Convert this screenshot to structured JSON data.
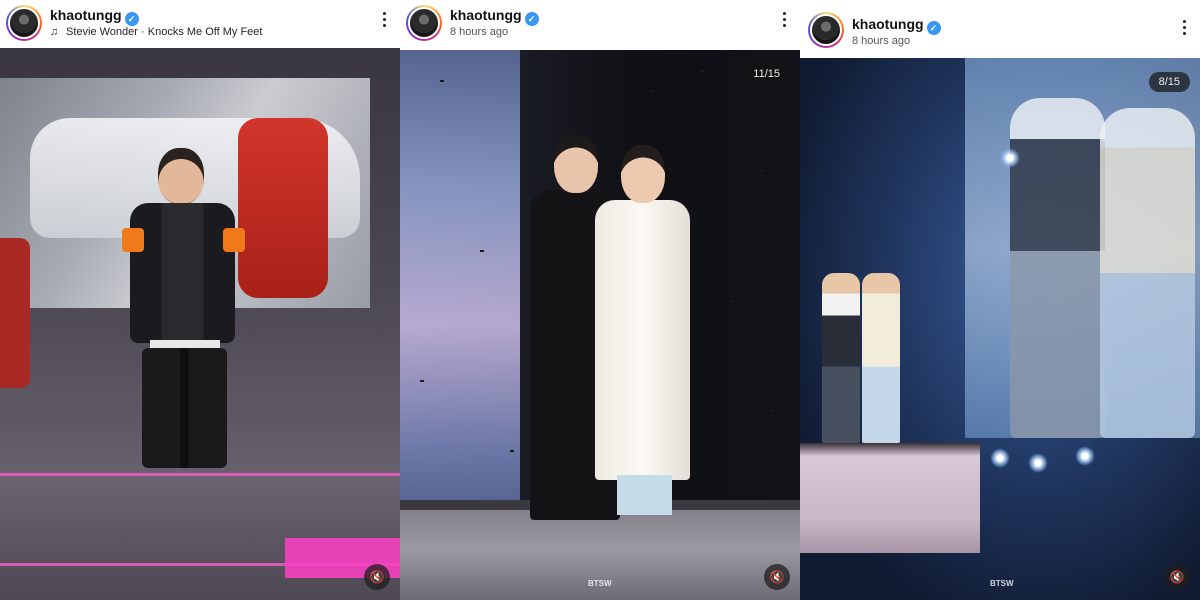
{
  "posts": [
    {
      "username": "khaotungg",
      "verified": true,
      "music_artist": "Stevie Wonder",
      "music_separator": "·",
      "music_title": "Knocks Me Off My Feet",
      "counter": "",
      "watermark": "",
      "icons": {
        "music": "music-note-icon",
        "verified": "verified-badge-icon",
        "more": "more-options-icon",
        "mute": "muted-speaker-icon"
      }
    },
    {
      "username": "khaotungg",
      "verified": true,
      "time": "8 hours ago",
      "counter": "11/15",
      "watermark": "BTSW",
      "icons": {
        "verified": "verified-badge-icon",
        "more": "more-options-icon",
        "mute": "muted-speaker-icon"
      }
    },
    {
      "username": "khaotungg",
      "verified": true,
      "time": "8 hours ago",
      "counter": "8/15",
      "watermark": "BTSW",
      "icons": {
        "verified": "verified-badge-icon",
        "more": "more-options-icon",
        "mute": "muted-speaker-icon"
      }
    }
  ],
  "colors": {
    "verified": "#3897f0",
    "stage_pink": "#ff3fc6",
    "counter_bg": "#141414"
  }
}
